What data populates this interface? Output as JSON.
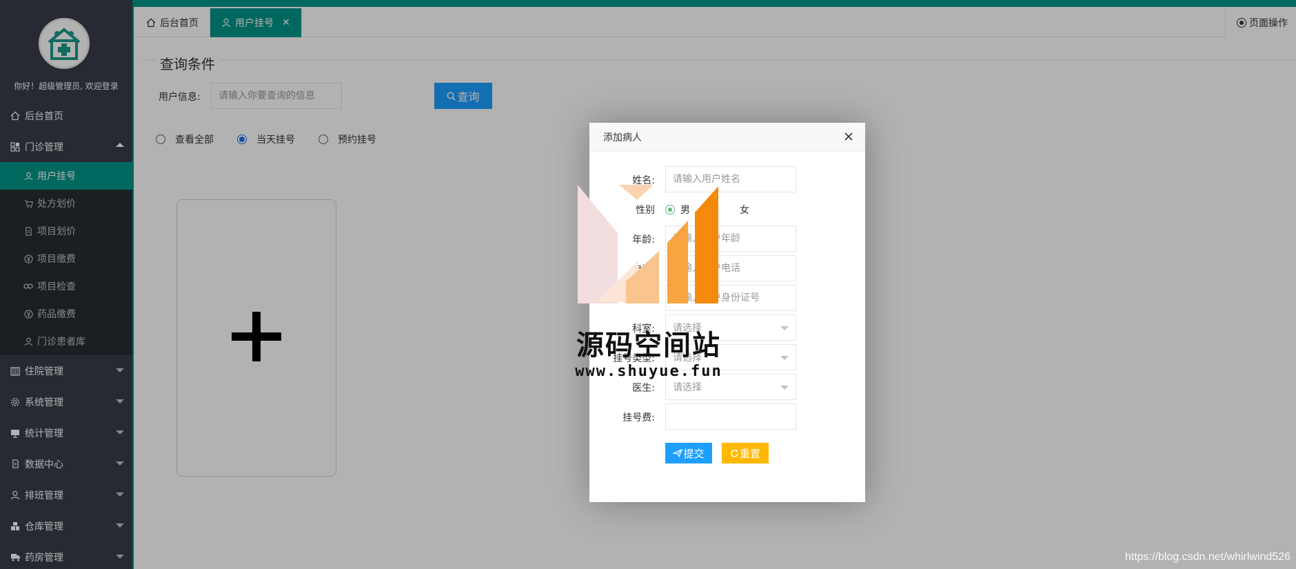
{
  "sidebar": {
    "greeting": "你好！超级管理员, 欢迎登录",
    "items": [
      {
        "label": "后台首页",
        "icon": "home-icon"
      },
      {
        "label": "门诊管理",
        "icon": "grid-icon",
        "open": true,
        "children": [
          {
            "label": "用户挂号",
            "icon": "user-icon",
            "active": true
          },
          {
            "label": "处方划价",
            "icon": "cart-icon"
          },
          {
            "label": "项目划价",
            "icon": "file-icon"
          },
          {
            "label": "项目缴费",
            "icon": "yen-icon"
          },
          {
            "label": "项目检查",
            "icon": "link-icon"
          },
          {
            "label": "药品缴费",
            "icon": "yen-icon"
          },
          {
            "label": "门诊患者库",
            "icon": "user-icon"
          }
        ]
      },
      {
        "label": "住院管理",
        "icon": "building-icon"
      },
      {
        "label": "系统管理",
        "icon": "gear-icon"
      },
      {
        "label": "统计管理",
        "icon": "monitor-icon"
      },
      {
        "label": "数据中心",
        "icon": "file-icon"
      },
      {
        "label": "排班管理",
        "icon": "user-icon"
      },
      {
        "label": "仓库管理",
        "icon": "cubes-icon"
      },
      {
        "label": "药房管理",
        "icon": "truck-icon"
      }
    ]
  },
  "tabs": [
    {
      "label": "后台首页",
      "icon": "home-icon"
    },
    {
      "label": "用户挂号",
      "icon": "user-icon",
      "active": true
    }
  ],
  "page_ops": {
    "label": "页面操作"
  },
  "query": {
    "title": "查询条件",
    "user_info_label": "用户信息:",
    "user_info_placeholder": "请输入你要查询的信息",
    "search_button": "查询",
    "filters": [
      {
        "label": "查看全部",
        "checked": false
      },
      {
        "label": "当天挂号",
        "checked": true
      },
      {
        "label": "预约挂号",
        "checked": false
      }
    ]
  },
  "modal": {
    "title": "添加病人",
    "fields": {
      "name": {
        "label": "姓名:",
        "placeholder": "请输入用户姓名"
      },
      "gender": {
        "label": "性别",
        "options": [
          "男",
          "女"
        ],
        "selected": "男"
      },
      "age": {
        "label": "年龄:",
        "placeholder": "请输入用户年龄"
      },
      "phone": {
        "label": "电话:",
        "placeholder": "请输入用户电话"
      },
      "idcard": {
        "label": "证件号:",
        "placeholder": "请输入用户身份证号"
      },
      "dept": {
        "label": "科室:",
        "value": "请选择"
      },
      "reg_type": {
        "label": "挂号类型:",
        "value": "请选择"
      },
      "doctor": {
        "label": "医生:",
        "value": "请选择"
      },
      "fee": {
        "label": "挂号费:",
        "value": ""
      }
    },
    "submit": "提交",
    "reset": "重置"
  },
  "watermark": {
    "title": "源码空间站",
    "url": "www.shuyue.fun"
  },
  "credit": "https://blog.csdn.net/whirlwind526",
  "colors": {
    "accent": "#009688",
    "sidebar": "#393d49",
    "primary": "#1e9fff",
    "warm": "#ffb800"
  }
}
